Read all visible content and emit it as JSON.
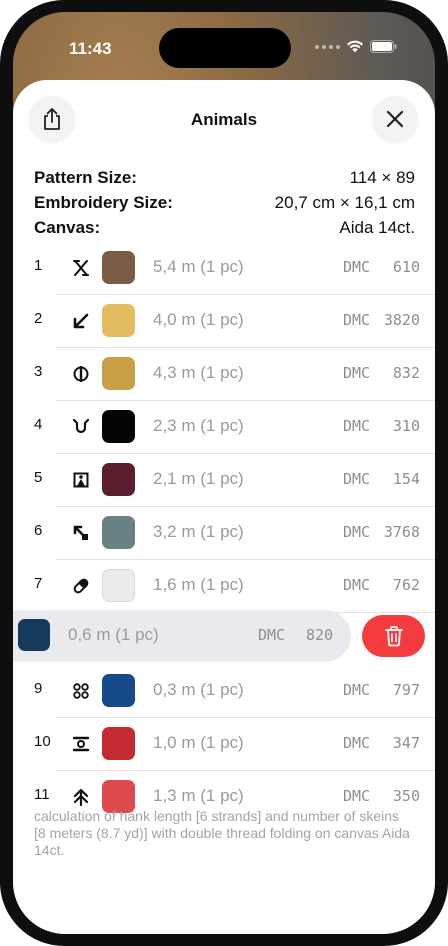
{
  "status_bar": {
    "time": "11:43"
  },
  "header": {
    "title": "Animals"
  },
  "info": {
    "pattern_size": {
      "label": "Pattern Size:",
      "value": "114 × 89"
    },
    "embroidery_size": {
      "label": "Embroidery Size:",
      "value": "20,7 cm × 16,1 cm"
    },
    "canvas": {
      "label": "Canvas:",
      "value": "Aida 14ct."
    }
  },
  "threads": [
    {
      "num": "1",
      "symbol": "cross-x",
      "color": "#7a5c45",
      "length": "5,4 m (1 pc)",
      "brand": "DMC",
      "code": "610"
    },
    {
      "num": "2",
      "symbol": "arrow-down-left",
      "color": "#e3bb61",
      "length": "4,0 m (1 pc)",
      "brand": "DMC",
      "code": "3820"
    },
    {
      "num": "3",
      "symbol": "circle-bar",
      "color": "#c8a048",
      "length": "4,3 m (1 pc)",
      "brand": "DMC",
      "code": "832"
    },
    {
      "num": "4",
      "symbol": "cup-v",
      "color": "#040404",
      "length": "2,3 m (1 pc)",
      "brand": "DMC",
      "code": "310"
    },
    {
      "num": "5",
      "symbol": "picture-frame",
      "color": "#5a1f2c",
      "length": "2,1 m (1 pc)",
      "brand": "DMC",
      "code": "154"
    },
    {
      "num": "6",
      "symbol": "arrow-up-left-square",
      "color": "#6a8183",
      "length": "3,2 m (1 pc)",
      "brand": "DMC",
      "code": "3768"
    },
    {
      "num": "7",
      "symbol": "capsule",
      "color": "#ececec",
      "length": "1,6 m (1 pc)",
      "brand": "DMC",
      "code": "762"
    },
    {
      "num": "9",
      "symbol": "four-circles",
      "color": "#174a8b",
      "length": "0,3 m (1 pc)",
      "brand": "DMC",
      "code": "797"
    },
    {
      "num": "10",
      "symbol": "circle-in-bars",
      "color": "#c42a32",
      "length": "1,0 m (1 pc)",
      "brand": "DMC",
      "code": "347"
    },
    {
      "num": "11",
      "symbol": "double-chevron-up",
      "color": "#de4b4f",
      "length": "1,3 m (1 pc)",
      "brand": "DMC",
      "code": "350"
    }
  ],
  "swiped_thread": {
    "color": "#143a5e",
    "length": "0,6 m (1 pc)",
    "brand": "DMC",
    "code": "820"
  },
  "footnote": "calculation of hank length [6 strands] and number of skeins [8 meters (8.7 yd)] with double thread folding on canvas Aida 14ct.",
  "colors": {
    "delete": "#f43c3f",
    "label_gray": "#9a9a9f"
  }
}
